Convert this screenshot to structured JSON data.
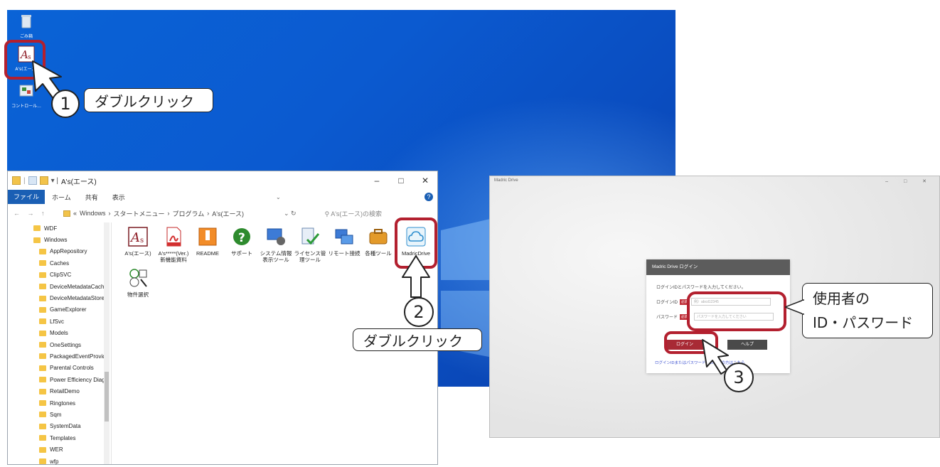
{
  "annotations": {
    "step1": {
      "number": "1",
      "label": "ダブルクリック"
    },
    "step2": {
      "number": "2",
      "label": "ダブルクリック"
    },
    "step3": {
      "number": "3"
    },
    "credentials_callout": {
      "line1": "使用者の",
      "line2": "ID・パスワード"
    },
    "highlight_color": "#b3202f"
  },
  "desktop": {
    "icons": [
      {
        "name": "recycle-bin",
        "label": "ごみ箱"
      },
      {
        "name": "as-shortcut",
        "label": "A's(エース)"
      },
      {
        "name": "control-panel",
        "label": "コントロール..."
      }
    ]
  },
  "explorer": {
    "title": "A's(エース)",
    "window_controls": {
      "minimize": "–",
      "maximize": "□",
      "close": "✕"
    },
    "ribbon_tabs": [
      "ファイル",
      "ホーム",
      "共有",
      "表示"
    ],
    "address_path": [
      "Windows",
      "スタートメニュー",
      "プログラム",
      "A's(エース)"
    ],
    "search_placeholder": "A's(エース)の検索",
    "tree_items": [
      "WDF",
      "Windows",
      "AppRepository",
      "Caches",
      "ClipSVC",
      "DeviceMetadataCache",
      "DeviceMetadataStore",
      "GameExplorer",
      "LfSvc",
      "Models",
      "OneSettings",
      "PackagedEventProvid",
      "Parental Controls",
      "Power Efficiency Diag",
      "RetailDemo",
      "Ringtones",
      "Sqm",
      "SystemData",
      "Templates",
      "WER",
      "wfp"
    ],
    "files": [
      {
        "label": "A's(エース)",
        "icon": "as-app-icon"
      },
      {
        "label": "A's*****(Ver.)新機能資料",
        "icon": "pdf-icon"
      },
      {
        "label": "README",
        "icon": "readme-icon"
      },
      {
        "label": "サポート",
        "icon": "help-icon"
      },
      {
        "label": "システム情報表示ツール",
        "icon": "system-info-icon"
      },
      {
        "label": "ライセンス管理ツール",
        "icon": "license-icon"
      },
      {
        "label": "リモート接続",
        "icon": "remote-icon"
      },
      {
        "label": "各種ツール",
        "icon": "tools-icon"
      },
      {
        "label": "MadricDrive",
        "icon": "cloud-icon"
      },
      {
        "label": "物件選択",
        "icon": "property-icon"
      }
    ]
  },
  "login_window": {
    "title": "Madric Drive",
    "controls": "– □ ✕",
    "dialog_title": "Madric Drive ログイン",
    "instruction": "ログインIDとパスワードを入力してください。",
    "id_label": "ログインID",
    "password_label": "パスワード",
    "required_badge": "必須",
    "id_placeholder": "例）abcd12345",
    "password_placeholder": "パスワードを入力してください",
    "login_button": "ログイン",
    "help_button": "ヘルプ",
    "forgot_link": "ログインIDまたはパスワードをお忘れの方はこちら"
  }
}
